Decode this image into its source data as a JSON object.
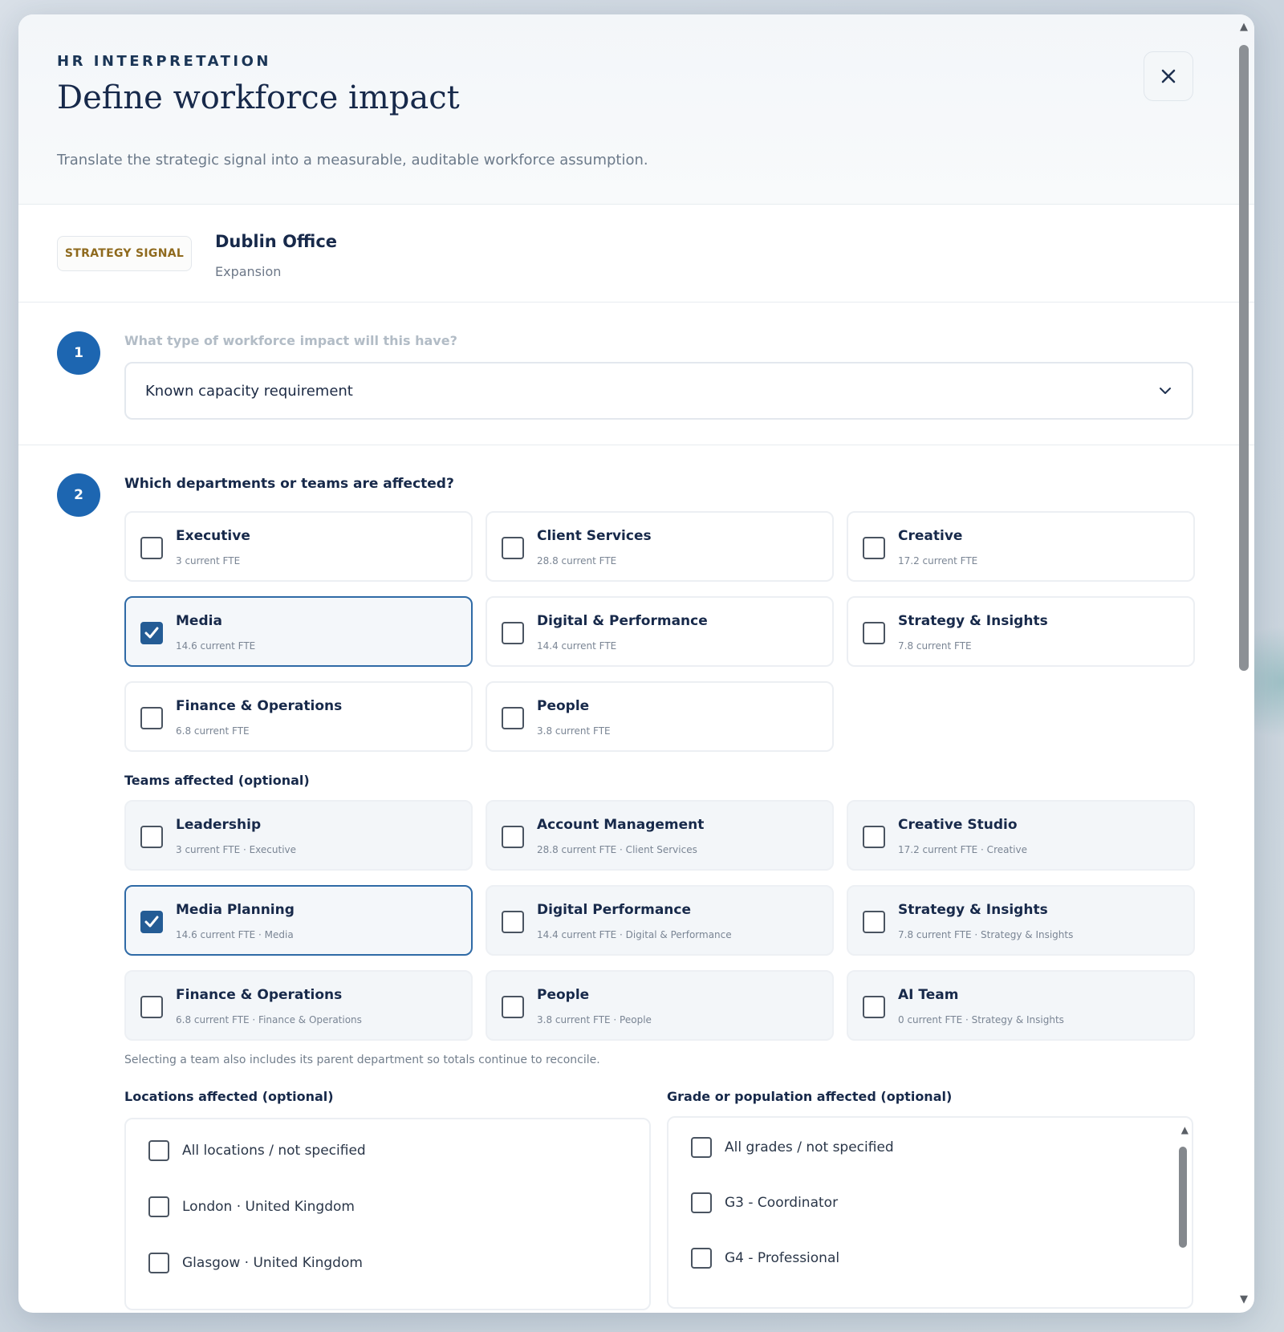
{
  "header": {
    "eyebrow": "HR INTERPRETATION",
    "title": "Define workforce impact",
    "subtitle": "Translate the strategic signal into a measurable, auditable workforce assumption.",
    "close_icon": "close-icon"
  },
  "signal": {
    "badge": "STRATEGY SIGNAL",
    "name": "Dublin Office",
    "type": "Expansion"
  },
  "step1": {
    "number": "1",
    "question": "What type of workforce impact will this have?",
    "select_value": "Known capacity requirement",
    "chevron_icon": "chevron-down-icon"
  },
  "step2": {
    "number": "2",
    "question": "Which departments or teams are affected?",
    "departments": [
      {
        "title": "Executive",
        "sub": "3 current FTE",
        "checked": false
      },
      {
        "title": "Client Services",
        "sub": "28.8 current FTE",
        "checked": false
      },
      {
        "title": "Creative",
        "sub": "17.2 current FTE",
        "checked": false
      },
      {
        "title": "Media",
        "sub": "14.6 current FTE",
        "checked": true
      },
      {
        "title": "Digital & Performance",
        "sub": "14.4 current FTE",
        "checked": false
      },
      {
        "title": "Strategy & Insights",
        "sub": "7.8 current FTE",
        "checked": false
      },
      {
        "title": "Finance & Operations",
        "sub": "6.8 current FTE",
        "checked": false
      },
      {
        "title": "People",
        "sub": "3.8 current FTE",
        "checked": false
      }
    ],
    "teams_label": "Teams affected (optional)",
    "teams": [
      {
        "title": "Leadership",
        "sub": "3 current FTE · Executive",
        "checked": false
      },
      {
        "title": "Account Management",
        "sub": "28.8 current FTE · Client Services",
        "checked": false
      },
      {
        "title": "Creative Studio",
        "sub": "17.2 current FTE · Creative",
        "checked": false
      },
      {
        "title": "Media Planning",
        "sub": "14.6 current FTE · Media",
        "checked": true
      },
      {
        "title": "Digital Performance",
        "sub": "14.4 current FTE · Digital & Performance",
        "checked": false
      },
      {
        "title": "Strategy & Insights",
        "sub": "7.8 current FTE · Strategy & Insights",
        "checked": false
      },
      {
        "title": "Finance & Operations",
        "sub": "6.8 current FTE · Finance & Operations",
        "checked": false
      },
      {
        "title": "People",
        "sub": "3.8 current FTE · People",
        "checked": false
      },
      {
        "title": "AI Team",
        "sub": "0 current FTE · Strategy & Insights",
        "checked": false
      }
    ],
    "helper": "Selecting a team also includes its parent department so totals continue to reconcile.",
    "locations_label": "Locations affected (optional)",
    "locations": [
      "All locations / not specified",
      "London · United Kingdom",
      "Glasgow · United Kingdom"
    ],
    "grades_label": "Grade or population affected (optional)",
    "grades": [
      "All grades / not specified",
      "G3 - Coordinator",
      "G4 - Professional"
    ]
  },
  "colors": {
    "accent": "#1d66b1",
    "checked_border": "#2f6aa6",
    "badge_text": "#8f6a1e"
  }
}
